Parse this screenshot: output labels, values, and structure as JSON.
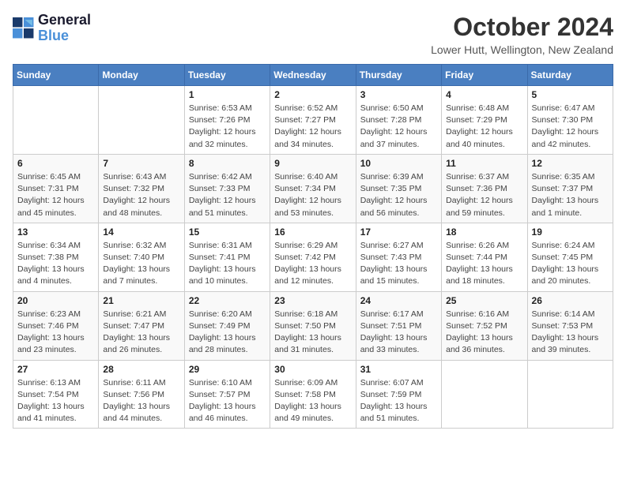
{
  "header": {
    "logo_line1": "General",
    "logo_line2": "Blue",
    "title": "October 2024",
    "subtitle": "Lower Hutt, Wellington, New Zealand"
  },
  "weekdays": [
    "Sunday",
    "Monday",
    "Tuesday",
    "Wednesday",
    "Thursday",
    "Friday",
    "Saturday"
  ],
  "weeks": [
    [
      {
        "day": "",
        "info": ""
      },
      {
        "day": "",
        "info": ""
      },
      {
        "day": "1",
        "info": "Sunrise: 6:53 AM\nSunset: 7:26 PM\nDaylight: 12 hours and 32 minutes."
      },
      {
        "day": "2",
        "info": "Sunrise: 6:52 AM\nSunset: 7:27 PM\nDaylight: 12 hours and 34 minutes."
      },
      {
        "day": "3",
        "info": "Sunrise: 6:50 AM\nSunset: 7:28 PM\nDaylight: 12 hours and 37 minutes."
      },
      {
        "day": "4",
        "info": "Sunrise: 6:48 AM\nSunset: 7:29 PM\nDaylight: 12 hours and 40 minutes."
      },
      {
        "day": "5",
        "info": "Sunrise: 6:47 AM\nSunset: 7:30 PM\nDaylight: 12 hours and 42 minutes."
      }
    ],
    [
      {
        "day": "6",
        "info": "Sunrise: 6:45 AM\nSunset: 7:31 PM\nDaylight: 12 hours and 45 minutes."
      },
      {
        "day": "7",
        "info": "Sunrise: 6:43 AM\nSunset: 7:32 PM\nDaylight: 12 hours and 48 minutes."
      },
      {
        "day": "8",
        "info": "Sunrise: 6:42 AM\nSunset: 7:33 PM\nDaylight: 12 hours and 51 minutes."
      },
      {
        "day": "9",
        "info": "Sunrise: 6:40 AM\nSunset: 7:34 PM\nDaylight: 12 hours and 53 minutes."
      },
      {
        "day": "10",
        "info": "Sunrise: 6:39 AM\nSunset: 7:35 PM\nDaylight: 12 hours and 56 minutes."
      },
      {
        "day": "11",
        "info": "Sunrise: 6:37 AM\nSunset: 7:36 PM\nDaylight: 12 hours and 59 minutes."
      },
      {
        "day": "12",
        "info": "Sunrise: 6:35 AM\nSunset: 7:37 PM\nDaylight: 13 hours and 1 minute."
      }
    ],
    [
      {
        "day": "13",
        "info": "Sunrise: 6:34 AM\nSunset: 7:38 PM\nDaylight: 13 hours and 4 minutes."
      },
      {
        "day": "14",
        "info": "Sunrise: 6:32 AM\nSunset: 7:40 PM\nDaylight: 13 hours and 7 minutes."
      },
      {
        "day": "15",
        "info": "Sunrise: 6:31 AM\nSunset: 7:41 PM\nDaylight: 13 hours and 10 minutes."
      },
      {
        "day": "16",
        "info": "Sunrise: 6:29 AM\nSunset: 7:42 PM\nDaylight: 13 hours and 12 minutes."
      },
      {
        "day": "17",
        "info": "Sunrise: 6:27 AM\nSunset: 7:43 PM\nDaylight: 13 hours and 15 minutes."
      },
      {
        "day": "18",
        "info": "Sunrise: 6:26 AM\nSunset: 7:44 PM\nDaylight: 13 hours and 18 minutes."
      },
      {
        "day": "19",
        "info": "Sunrise: 6:24 AM\nSunset: 7:45 PM\nDaylight: 13 hours and 20 minutes."
      }
    ],
    [
      {
        "day": "20",
        "info": "Sunrise: 6:23 AM\nSunset: 7:46 PM\nDaylight: 13 hours and 23 minutes."
      },
      {
        "day": "21",
        "info": "Sunrise: 6:21 AM\nSunset: 7:47 PM\nDaylight: 13 hours and 26 minutes."
      },
      {
        "day": "22",
        "info": "Sunrise: 6:20 AM\nSunset: 7:49 PM\nDaylight: 13 hours and 28 minutes."
      },
      {
        "day": "23",
        "info": "Sunrise: 6:18 AM\nSunset: 7:50 PM\nDaylight: 13 hours and 31 minutes."
      },
      {
        "day": "24",
        "info": "Sunrise: 6:17 AM\nSunset: 7:51 PM\nDaylight: 13 hours and 33 minutes."
      },
      {
        "day": "25",
        "info": "Sunrise: 6:16 AM\nSunset: 7:52 PM\nDaylight: 13 hours and 36 minutes."
      },
      {
        "day": "26",
        "info": "Sunrise: 6:14 AM\nSunset: 7:53 PM\nDaylight: 13 hours and 39 minutes."
      }
    ],
    [
      {
        "day": "27",
        "info": "Sunrise: 6:13 AM\nSunset: 7:54 PM\nDaylight: 13 hours and 41 minutes."
      },
      {
        "day": "28",
        "info": "Sunrise: 6:11 AM\nSunset: 7:56 PM\nDaylight: 13 hours and 44 minutes."
      },
      {
        "day": "29",
        "info": "Sunrise: 6:10 AM\nSunset: 7:57 PM\nDaylight: 13 hours and 46 minutes."
      },
      {
        "day": "30",
        "info": "Sunrise: 6:09 AM\nSunset: 7:58 PM\nDaylight: 13 hours and 49 minutes."
      },
      {
        "day": "31",
        "info": "Sunrise: 6:07 AM\nSunset: 7:59 PM\nDaylight: 13 hours and 51 minutes."
      },
      {
        "day": "",
        "info": ""
      },
      {
        "day": "",
        "info": ""
      }
    ]
  ]
}
